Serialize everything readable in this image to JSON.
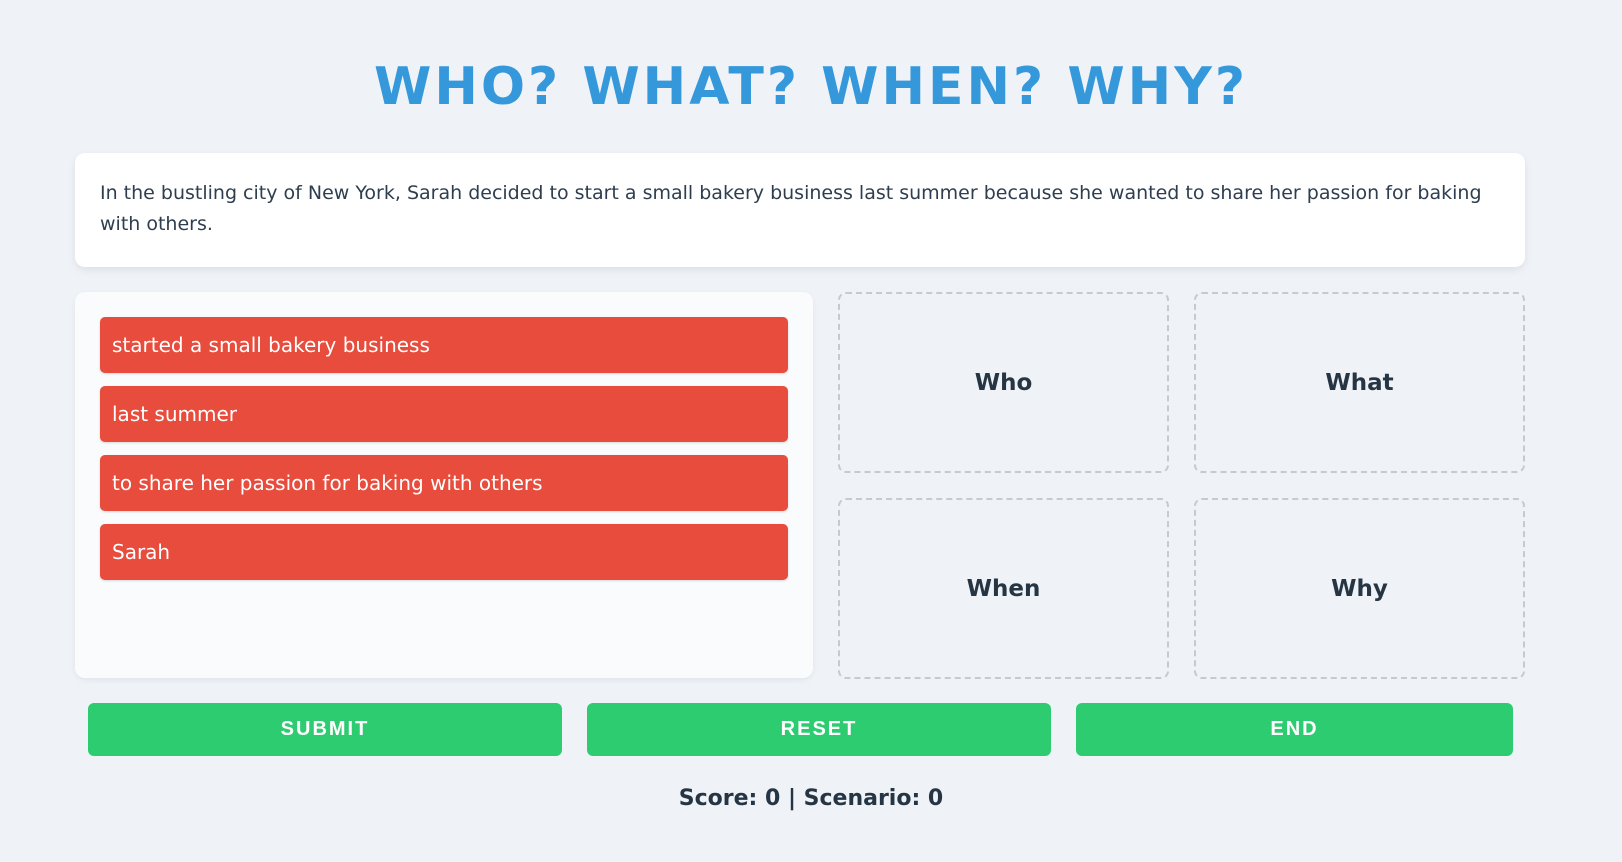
{
  "title": "WHO? WHAT? WHEN? WHY?",
  "scenario": {
    "text": "In the bustling city of New York, Sarah decided to start a small bakery business last summer because she wanted to share her passion for baking with others."
  },
  "phrases": [
    "started a small bakery business",
    "last summer",
    "to share her passion for baking with others",
    "Sarah"
  ],
  "dropzones": {
    "who": "Who",
    "what": "What",
    "when": "When",
    "why": "Why"
  },
  "buttons": {
    "submit": "SUBMIT",
    "reset": "RESET",
    "end": "END"
  },
  "status": {
    "text": "Score: 0 | Scenario: 0"
  },
  "colors": {
    "background": "#eff3f8",
    "title": "#3598db",
    "phrase": "#e74c3c",
    "button": "#2ecc71",
    "text": "#263544"
  }
}
